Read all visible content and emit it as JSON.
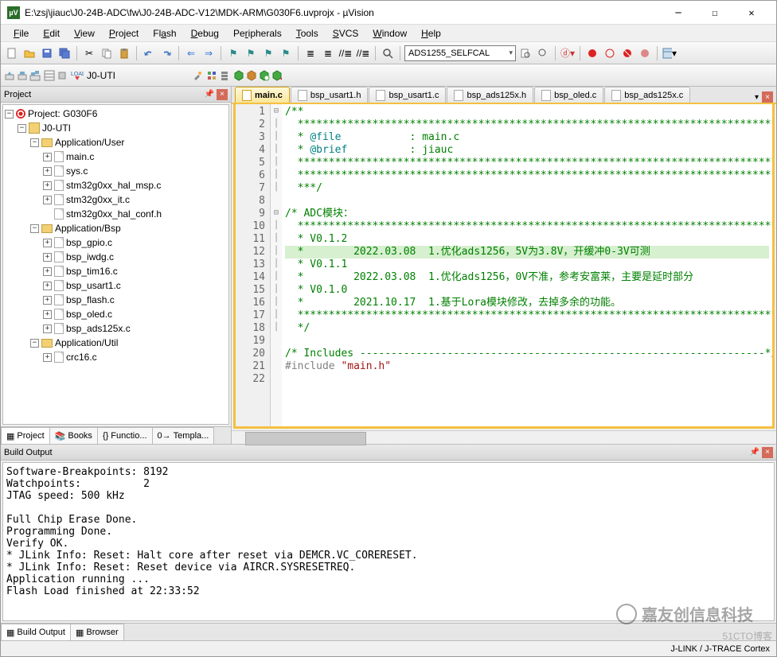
{
  "window": {
    "title": "E:\\zsj\\jiauc\\J0-24B-ADC\\fw\\J0-24B-ADC-V12\\MDK-ARM\\G030F6.uvprojx - µVision"
  },
  "menu": [
    "File",
    "Edit",
    "View",
    "Project",
    "Flash",
    "Debug",
    "Peripherals",
    "Tools",
    "SVCS",
    "Window",
    "Help"
  ],
  "toolbar": {
    "combo1": "ADS1255_SELFCAL",
    "target_combo": "J0-UTI"
  },
  "project_panel": {
    "title": "Project",
    "root": "Project: G030F6",
    "target": "J0-UTI",
    "groups": [
      {
        "name": "Application/User",
        "files": [
          "main.c",
          "sys.c",
          "stm32g0xx_hal_msp.c",
          "stm32g0xx_it.c",
          "stm32g0xx_hal_conf.h"
        ]
      },
      {
        "name": "Application/Bsp",
        "files": [
          "bsp_gpio.c",
          "bsp_iwdg.c",
          "bsp_tim16.c",
          "bsp_usart1.c",
          "bsp_flash.c",
          "bsp_oled.c",
          "bsp_ads125x.c"
        ]
      },
      {
        "name": "Application/Util",
        "files": [
          "crc16.c"
        ]
      }
    ],
    "tabs": [
      {
        "label": "Project",
        "icon": "project",
        "active": true
      },
      {
        "label": "Books",
        "icon": "books"
      },
      {
        "label": "Functio...",
        "icon": "functions"
      },
      {
        "label": "Templa...",
        "icon": "templates"
      }
    ]
  },
  "editor": {
    "tabs": [
      {
        "name": "main.c",
        "active": true
      },
      {
        "name": "bsp_usart1.h"
      },
      {
        "name": "bsp_usart1.c"
      },
      {
        "name": "bsp_ads125x.h"
      },
      {
        "name": "bsp_oled.c"
      },
      {
        "name": "bsp_ads125x.c"
      }
    ],
    "lines_start": 1,
    "lines_end": 22,
    "highlighted_line": 12,
    "code": [
      "/**",
      "  ********************************************************************************************",
      "  * @file           : main.c",
      "  * @brief          : jiauc",
      "  ********************************************************************************************",
      "  ********************************************************************************************",
      "  ***/",
      "",
      "/* ADC模块：",
      "  ********************************************************************************************",
      "  * V0.1.2",
      "  *        2022.03.08  1.优化ads1256，5V为3.8V，开缓冲0-3V可测",
      "  * V0.1.1",
      "  *        2022.03.08  1.优化ads1256，0V不准，参考安富莱，主要是延时部分",
      "  * V0.1.0",
      "  *        2021.10.17  1.基于Lora模块修改，去掉多余的功能。",
      "  ********************************************************************************************",
      "  */",
      "",
      "/* Includes -----------------------------------------------------------------*/",
      "#include \"main.h\"",
      ""
    ]
  },
  "build_output": {
    "title": "Build Output",
    "lines": [
      "Software-Breakpoints: 8192",
      "Watchpoints:          2",
      "JTAG speed: 500 kHz",
      "",
      "Full Chip Erase Done.",
      "Programming Done.",
      "Verify OK.",
      "* JLink Info: Reset: Halt core after reset via DEMCR.VC_CORERESET.",
      "* JLink Info: Reset: Reset device via AIRCR.SYSRESETREQ.",
      "Application running ...",
      "Flash Load finished at 22:33:52"
    ],
    "tabs": [
      {
        "label": "Build Output",
        "active": true
      },
      {
        "label": "Browser"
      }
    ]
  },
  "statusbar": {
    "right": "J-LINK / J-TRACE Cortex"
  },
  "watermark": {
    "text": "嘉友创信息科技",
    "sub": "51CTO博客"
  }
}
